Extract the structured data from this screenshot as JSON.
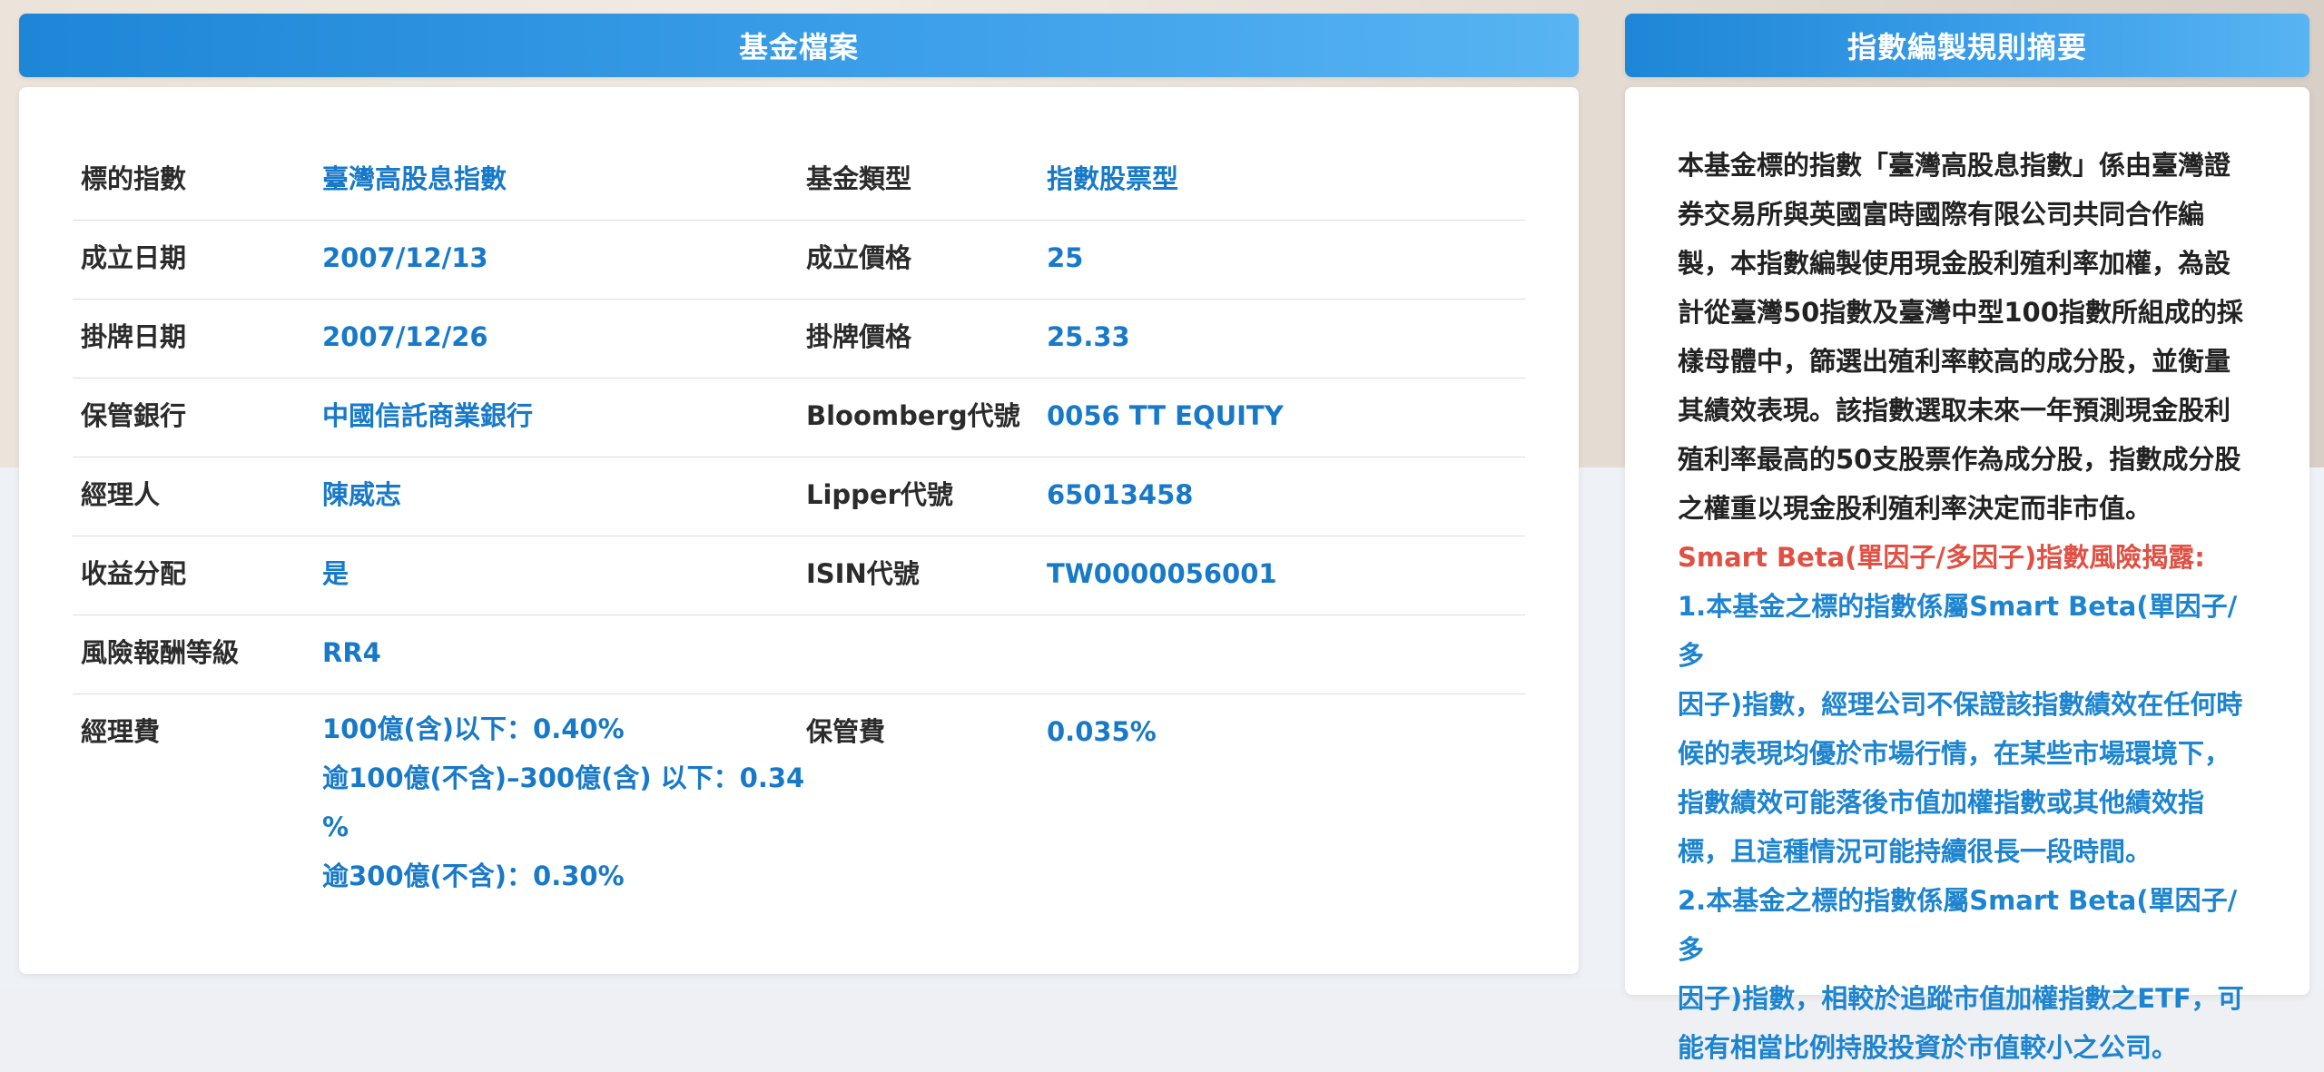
{
  "left_panel": {
    "title": "基金檔案",
    "rows": [
      {
        "label1": "標的指數",
        "value1": "臺灣高股息指數",
        "label2": "基金類型",
        "value2": "指數股票型"
      },
      {
        "label1": "成立日期",
        "value1": "2007/12/13",
        "label2": "成立價格",
        "value2": "25"
      },
      {
        "label1": "掛牌日期",
        "value1": "2007/12/26",
        "label2": "掛牌價格",
        "value2": "25.33"
      },
      {
        "label1": "保管銀行",
        "value1": "中國信託商業銀行",
        "label2": "Bloomberg代號",
        "value2": "0056 TT EQUITY"
      },
      {
        "label1": "經理人",
        "value1": "陳威志",
        "label2": "Lipper代號",
        "value2": "65013458"
      },
      {
        "label1": "收益分配",
        "value1": "是",
        "label2": "ISIN代號",
        "value2": "TW0000056001"
      },
      {
        "label1": "風險報酬等級",
        "value1": "RR4"
      },
      {
        "label1": "經理費",
        "value1_lines": [
          "100億(含)以下：0.40%",
          "逾100億(不含)–300億(含) 以下：0.34",
          "%",
          "逾300億(不含)：0.30%"
        ],
        "label2": "保管費",
        "value2": "0.035%"
      }
    ]
  },
  "right_panel": {
    "title": "指數編製規則摘要",
    "summary_lines": [
      "本基金標的指數「臺灣高股息指數」係由臺灣證",
      "券交易所與英國富時國際有限公司共同合作編",
      "製，本指數編製使用現金股利殖利率加權，為設",
      "計從臺灣50指數及臺灣中型100指數所組成的採",
      "樣母體中，篩選出殖利率較高的成分股，並衡量",
      "其績效表現。該指數選取未來一年預測現金股利",
      "殖利率最高的50支股票作為成分股，指數成分股",
      "之權重以現金股利殖利率決定而非市值。"
    ],
    "risk_title": "Smart Beta(單因子/多因子)指數風險揭露:",
    "risk_lines": [
      "1.本基金之標的指數係屬Smart Beta(單因子/多",
      "因子)指數，經理公司不保證該指數績效在任何時",
      "候的表現均優於市場行情，在某些市場環境下，",
      "指數績效可能落後市值加權指數或其他績效指",
      "標，且這種情況可能持續很長一段時間。",
      "2.本基金之標的指數係屬Smart Beta(單因子/多",
      "因子)指數，相較於追蹤市值加權指數之ETF，可",
      "能有相當比例持股投資於市值較小之公司。"
    ]
  },
  "colors": {
    "header_start": "#1d86d6",
    "header_end": "#58b4f2",
    "value_blue": "#1779c8",
    "risk_red": "#e05144",
    "risk_blue": "#1d84d0"
  }
}
